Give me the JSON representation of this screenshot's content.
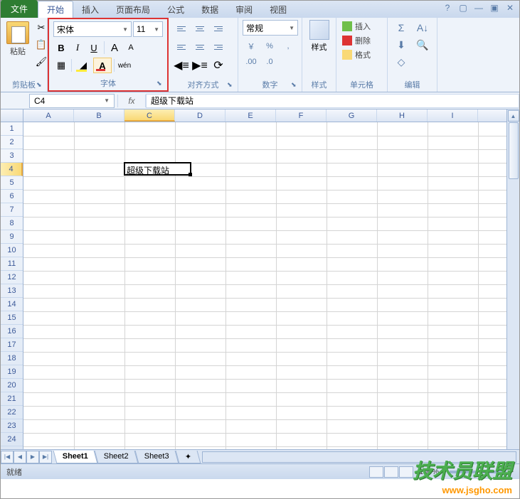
{
  "tabs": {
    "file": "文件",
    "home": "开始",
    "insert": "插入",
    "layout": "页面布局",
    "formula": "公式",
    "data": "数据",
    "review": "审阅",
    "view": "视图"
  },
  "ribbon": {
    "clipboard": {
      "label": "剪贴板",
      "paste": "粘贴"
    },
    "font": {
      "label": "字体",
      "name": "宋体",
      "size": "11",
      "bold": "B",
      "italic": "I",
      "underline": "U",
      "grow": "A",
      "shrink": "A",
      "color": "A",
      "phonetic": "wén"
    },
    "align": {
      "label": "对齐方式"
    },
    "number": {
      "label": "数字",
      "format": "常规",
      "currency": "￥",
      "percent": "%",
      "comma": ",",
      "inc": ".00",
      "dec": ".0"
    },
    "style": {
      "label": "样式",
      "btn": "样式"
    },
    "cells": {
      "label": "单元格",
      "insert": "插入",
      "delete": "删除",
      "format": "格式"
    },
    "edit": {
      "label": "编辑",
      "sum": "Σ",
      "fill": "⬇",
      "clear": "◇",
      "sort": "A↓",
      "find": "🔍"
    }
  },
  "formula_bar": {
    "name_box": "C4",
    "fx": "fx",
    "value": "超级下载站"
  },
  "columns": [
    "A",
    "B",
    "C",
    "D",
    "E",
    "F",
    "G",
    "H",
    "I"
  ],
  "rows": [
    "1",
    "2",
    "3",
    "4",
    "5",
    "6",
    "7",
    "8",
    "9",
    "10",
    "11",
    "12",
    "13",
    "14",
    "15",
    "16",
    "17",
    "18",
    "19",
    "20",
    "21",
    "22",
    "23",
    "24"
  ],
  "active_cell": {
    "col": 2,
    "row": 3,
    "value": "超级下载站"
  },
  "sheet_tabs": [
    "Sheet1",
    "Sheet2",
    "Sheet3"
  ],
  "status": {
    "ready": "就绪",
    "zoom": "100%"
  },
  "watermark": {
    "text": "技术员联盟",
    "url": "www.jsgho.com"
  }
}
